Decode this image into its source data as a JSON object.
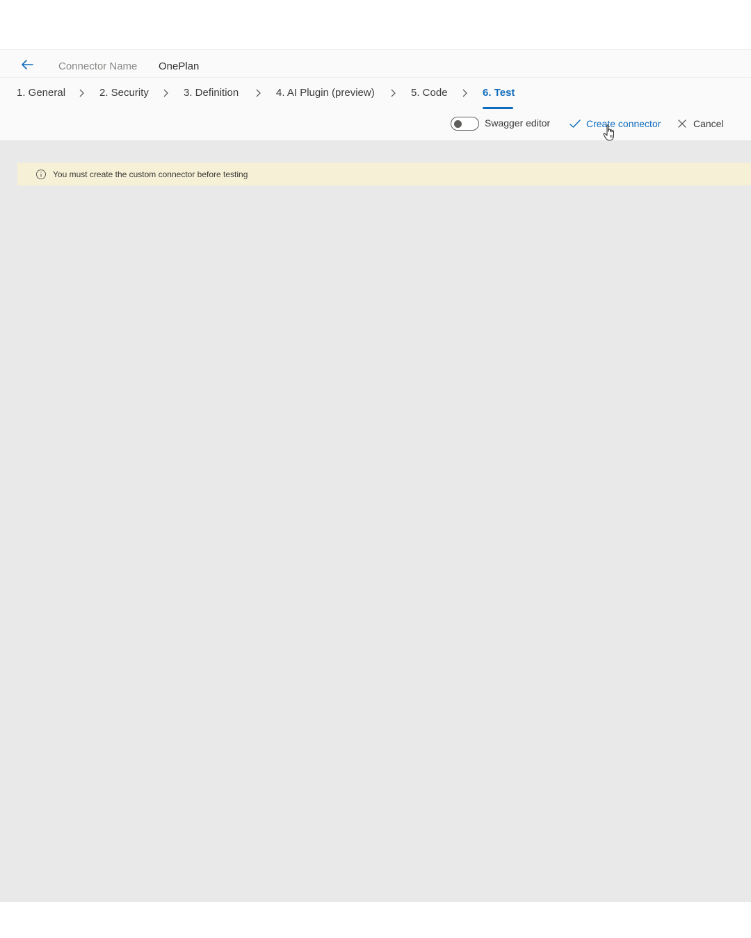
{
  "header": {
    "back_icon": "arrow-left-icon",
    "connector_label": "Connector Name",
    "connector_name": "OnePlan"
  },
  "steps": [
    {
      "label": "1. General",
      "active": false
    },
    {
      "label": "2. Security",
      "active": false
    },
    {
      "label": "3. Definition",
      "active": false
    },
    {
      "label": "4. AI Plugin (preview)",
      "active": false
    },
    {
      "label": "5. Code",
      "active": false
    },
    {
      "label": "6. Test",
      "active": true
    }
  ],
  "toolbar": {
    "swagger_toggle_label": "Swagger editor",
    "swagger_toggle_on": false,
    "create_label": "Create connector",
    "create_icon": "checkmark-icon",
    "cancel_label": "Cancel",
    "cancel_icon": "close-icon"
  },
  "warning": {
    "icon": "info-icon",
    "message": "You must create the custom connector before testing"
  },
  "colors": {
    "accent": "#0f6cbd",
    "warning_bg": "#f6f0d6",
    "content_bg": "#e9e9e9"
  }
}
